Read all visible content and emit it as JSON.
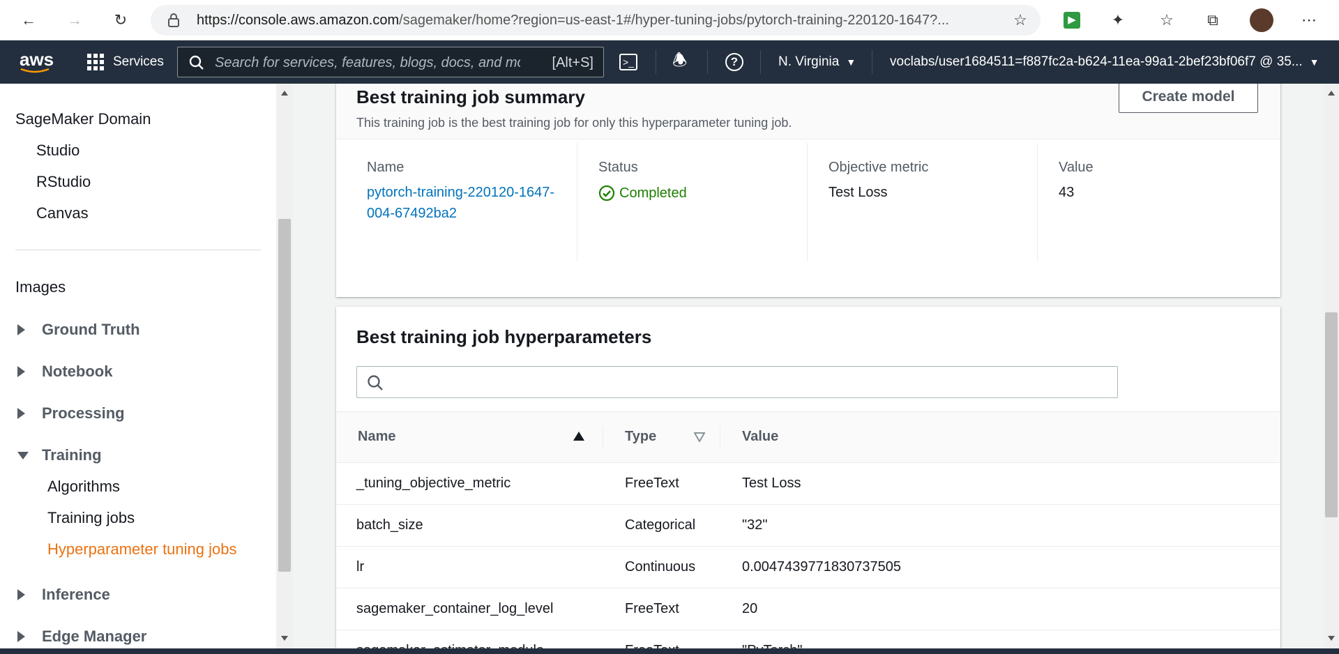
{
  "browser": {
    "url_host": "https://console.aws.amazon.com",
    "url_rest": "/sagemaker/home?region=us-east-1#/hyper-tuning-jobs/pytorch-training-220120-1647?..."
  },
  "aws_nav": {
    "logo": "aws",
    "services_label": "Services",
    "search_placeholder": "Search for services, features, blogs, docs, and more",
    "search_shortcut": "[Alt+S]",
    "region": "N. Virginia",
    "account": "voclabs/user1684511=f887fc2a-b624-11ea-99a1-2bef23bf06f7 @ 35..."
  },
  "sidebar": {
    "domain": "SageMaker Domain",
    "domain_items": [
      "Studio",
      "RStudio",
      "Canvas"
    ],
    "images": "Images",
    "groups": {
      "ground_truth": "Ground Truth",
      "notebook": "Notebook",
      "processing": "Processing",
      "training": "Training",
      "inference": "Inference",
      "edge_manager": "Edge Manager"
    },
    "training_items": [
      "Algorithms",
      "Training jobs",
      "Hyperparameter tuning jobs"
    ],
    "active_color": "#ec7211"
  },
  "summary": {
    "title": "Best training job summary",
    "description": "This training job is the best training job for only this hyperparameter tuning job.",
    "create_model": "Create model",
    "name_label": "Name",
    "name_value": "pytorch-training-220120-1647-004-67492ba2",
    "status_label": "Status",
    "status_value": "Completed",
    "metric_label": "Objective metric",
    "metric_value": "Test Loss",
    "value_label": "Value",
    "value_value": "43"
  },
  "hyperparameters": {
    "title": "Best training job hyperparameters",
    "search_value": "",
    "columns": {
      "name": "Name",
      "type": "Type",
      "value": "Value"
    },
    "rows": [
      {
        "name": "_tuning_objective_metric",
        "type": "FreeText",
        "value": "Test Loss"
      },
      {
        "name": "batch_size",
        "type": "Categorical",
        "value": "\"32\""
      },
      {
        "name": "lr",
        "type": "Continuous",
        "value": "0.0047439771830737505"
      },
      {
        "name": "sagemaker_container_log_level",
        "type": "FreeText",
        "value": "20"
      },
      {
        "name": "sagemaker_estimator_module",
        "type": "FreeText",
        "value": "\"PyTorch\""
      }
    ]
  },
  "colors": {
    "link": "#0073bb",
    "success": "#1d8102",
    "nav_bg": "#232f3e"
  }
}
